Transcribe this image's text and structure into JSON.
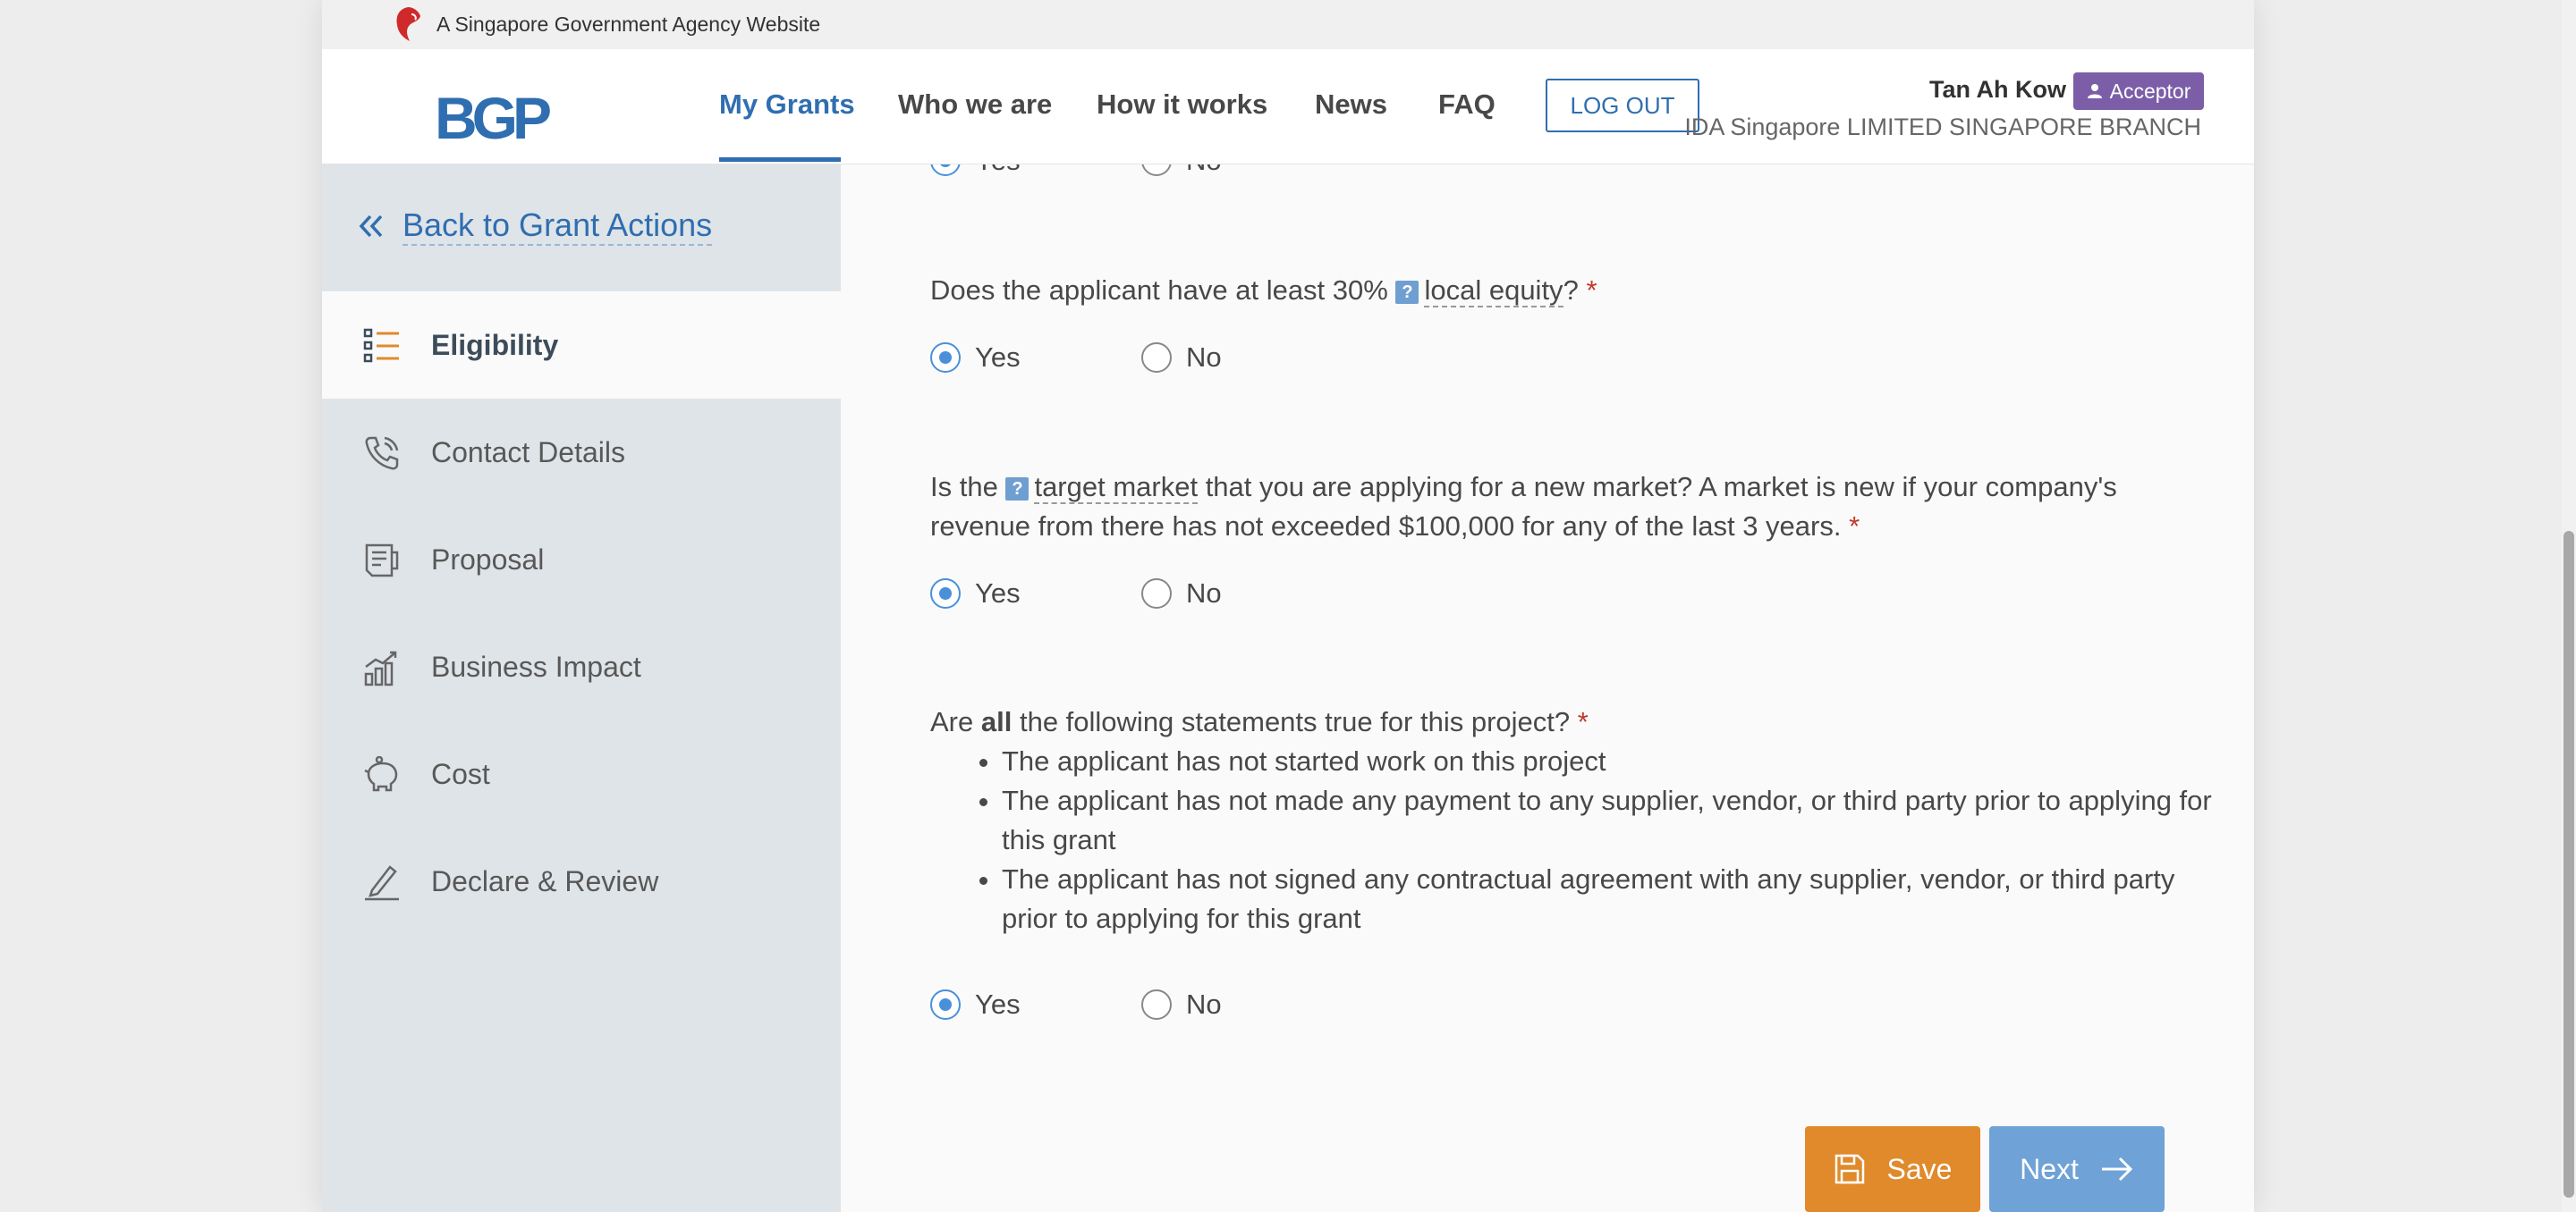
{
  "masthead": {
    "text": "A Singapore Government Agency Website"
  },
  "header": {
    "logo_text": "BGP",
    "nav": [
      {
        "label": "My Grants",
        "active": true
      },
      {
        "label": "Who we are"
      },
      {
        "label": "How it works"
      },
      {
        "label": "News"
      },
      {
        "label": "FAQ"
      }
    ],
    "logout_label": "LOG OUT",
    "user": {
      "name": "Tan Ah Kow",
      "role": "Acceptor",
      "company": "IDA Singapore LIMITED SINGAPORE BRANCH"
    }
  },
  "sidebar": {
    "back_label": "Back to Grant Actions",
    "items": [
      {
        "label": "Eligibility",
        "icon": "list-icon",
        "active": true
      },
      {
        "label": "Contact Details",
        "icon": "phone-icon"
      },
      {
        "label": "Proposal",
        "icon": "document-icon"
      },
      {
        "label": "Business Impact",
        "icon": "chart-icon"
      },
      {
        "label": "Cost",
        "icon": "piggy-bank-icon"
      },
      {
        "label": "Declare & Review",
        "icon": "signature-icon"
      }
    ]
  },
  "main": {
    "yes_label": "Yes",
    "no_label": "No",
    "questions": [
      {
        "pre": "Does the applicant have at least 30%",
        "term": "local equity",
        "post": "?",
        "required": "*",
        "answer": "Yes"
      },
      {
        "pre": "Is the",
        "term": "target market",
        "post": " that you are applying for a new market? A market is new if your company's revenue from there has not exceeded $100,000 for any of the last 3 years.",
        "required": "*",
        "answer": "Yes"
      },
      {
        "pre": "Are",
        "bold": "all",
        "post": "the following statements true for this project?",
        "required": "*",
        "bullets": [
          "The applicant has not started work on this project",
          "The applicant has not made any payment to any supplier, vendor, or third party prior to applying for this grant",
          "The applicant has not signed any contractual agreement with any supplier, vendor, or third party prior to applying for this grant"
        ],
        "answer": "Yes"
      }
    ],
    "tooltip_glyph": "?",
    "save_label": "Save",
    "next_label": "Next"
  },
  "colors": {
    "primary": "#2f6eb0",
    "accent_orange": "#e08a2c",
    "next_blue": "#6fa2d6",
    "role_purple": "#7b5ea7",
    "sidebar_bg": "#dfe4e8"
  }
}
